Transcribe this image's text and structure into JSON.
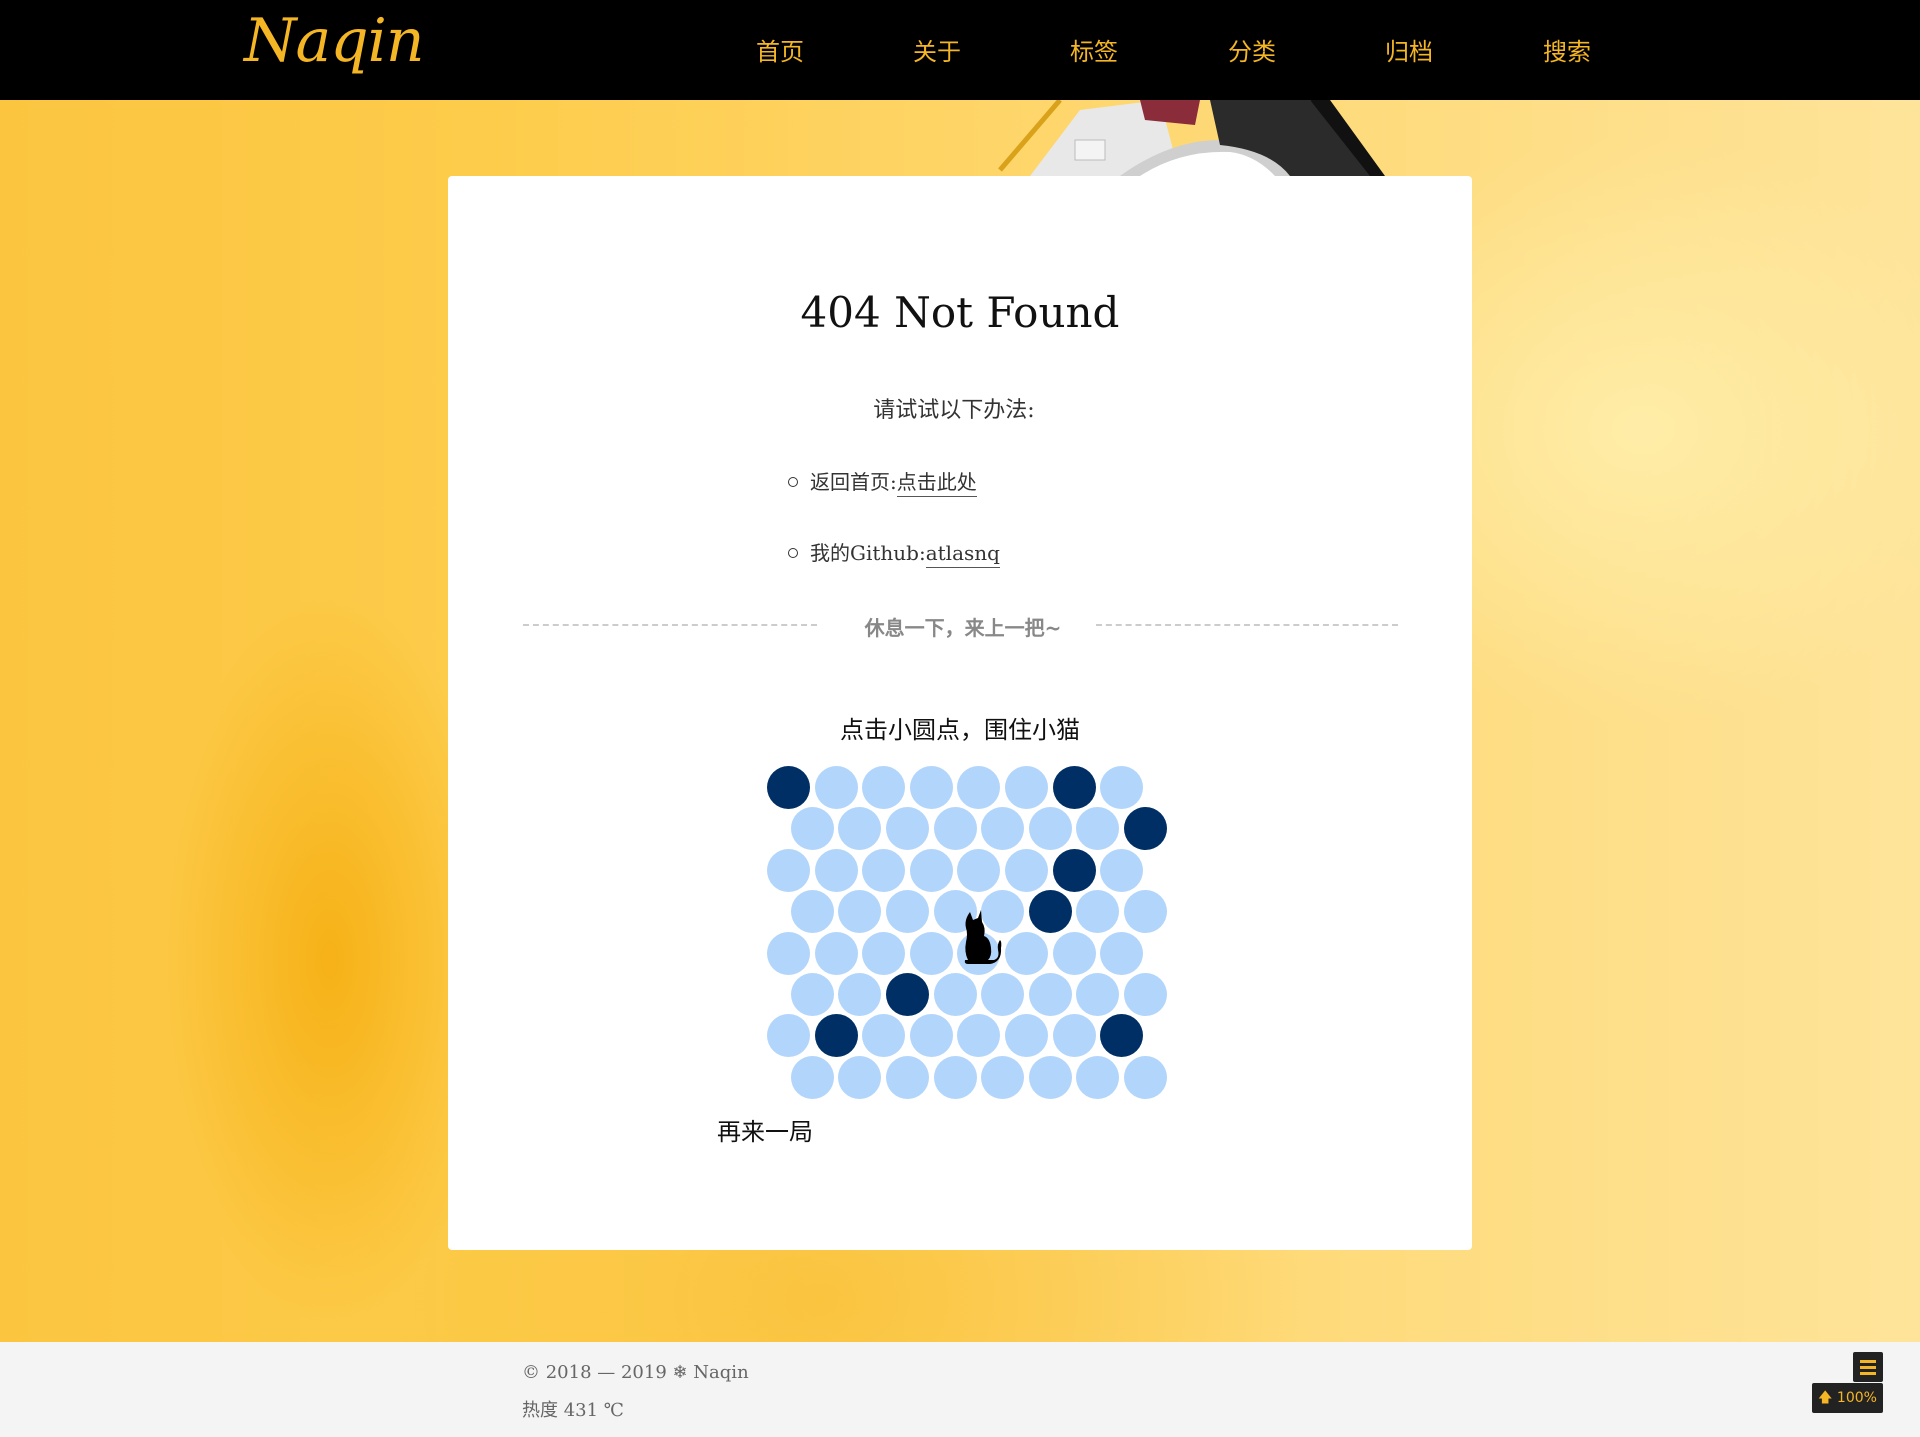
{
  "site": {
    "logo": "Naqin"
  },
  "nav": {
    "items": [
      {
        "label": "首页"
      },
      {
        "label": "关于"
      },
      {
        "label": "标签"
      },
      {
        "label": "分类"
      },
      {
        "label": "归档"
      },
      {
        "label": "搜索"
      }
    ]
  },
  "page": {
    "title": "404 Not Found",
    "subtitle": "请试试以下办法:",
    "links": [
      {
        "prefix": "返回首页:",
        "link_text": "点击此处"
      },
      {
        "prefix": "我的Github:",
        "link_text": "atlasnq"
      }
    ],
    "divider_text": "休息一下，来上一把~"
  },
  "game": {
    "title": "点击小圆点，围住小猫",
    "restart_label": "再来一局",
    "colors": {
      "empty": "#b2d5fb",
      "wall": "#002f66",
      "cat": "#000000"
    },
    "rows": [
      "WEEEEEWE",
      "EEEEEEEW",
      "EEEEEEWE",
      "EEEEEWEE",
      "EEEECEEE",
      "EEWEEEEE",
      "EWEEEEEW",
      "EEEEEEEE"
    ],
    "cat_position": {
      "row": 4,
      "col": 4
    }
  },
  "footer": {
    "copyright": "© 2018 — 2019 ❄ Naqin",
    "heat": "热度  431  ℃"
  },
  "widgets": {
    "menu_icon": "hamburger-icon",
    "back_to_top_label": "100%",
    "back_to_top_icon": "arrow-up-icon"
  },
  "colors": {
    "accent": "#f5b625",
    "navbar": "#000000",
    "footer": "#f4f4f4"
  }
}
